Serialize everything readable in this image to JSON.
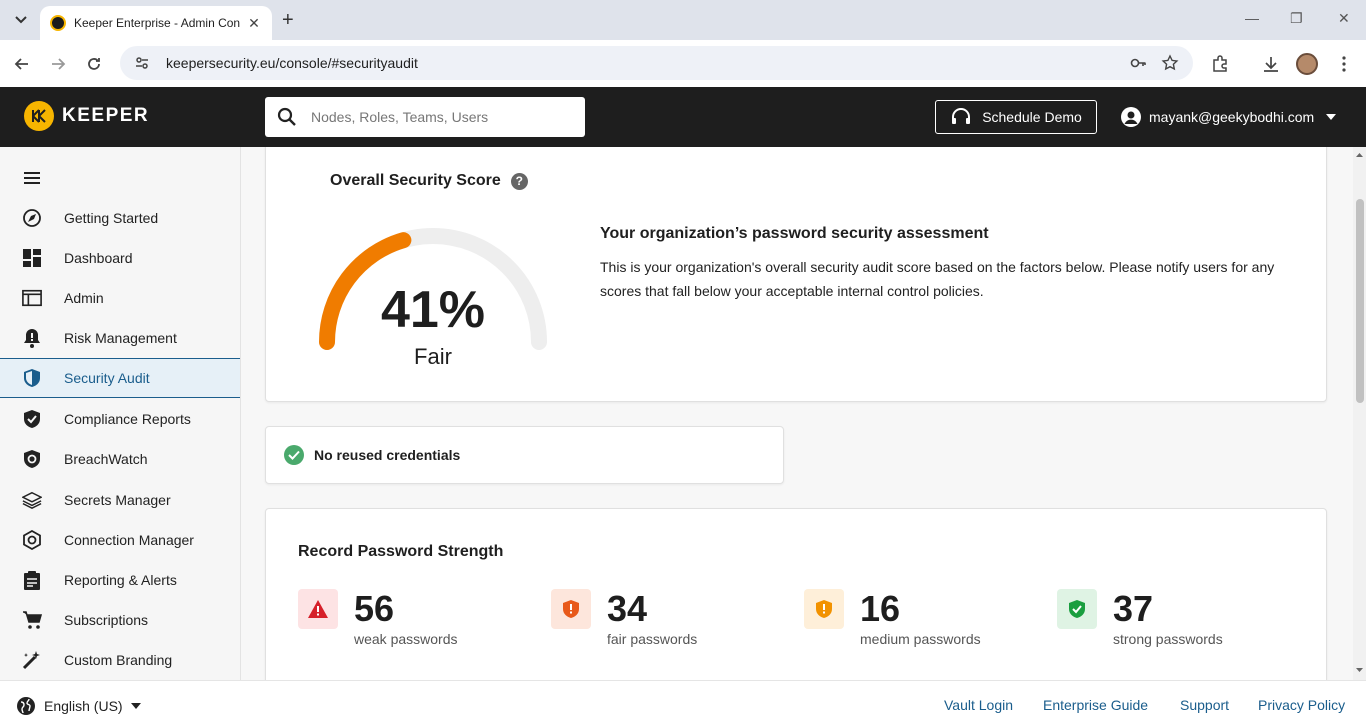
{
  "browser": {
    "tab_title": "Keeper Enterprise - Admin Con",
    "url": "keepersecurity.eu/console/#securityaudit"
  },
  "header": {
    "logo_text": "KEEPER",
    "search_placeholder": "Nodes, Roles, Teams, Users",
    "schedule_demo": "Schedule Demo",
    "user_email": "mayank@geekybodhi.com"
  },
  "sidebar": {
    "items": [
      {
        "label": "Getting Started",
        "icon": "rocket-icon"
      },
      {
        "label": "Dashboard",
        "icon": "dashboard-icon"
      },
      {
        "label": "Admin",
        "icon": "admin-icon"
      },
      {
        "label": "Risk Management",
        "icon": "bell-icon"
      },
      {
        "label": "Security Audit",
        "icon": "shield-icon",
        "active": true
      },
      {
        "label": "Compliance Reports",
        "icon": "compliance-icon"
      },
      {
        "label": "BreachWatch",
        "icon": "breachwatch-icon"
      },
      {
        "label": "Secrets Manager",
        "icon": "layers-icon"
      },
      {
        "label": "Connection Manager",
        "icon": "connection-icon"
      },
      {
        "label": "Reporting & Alerts",
        "icon": "clipboard-icon"
      },
      {
        "label": "Subscriptions",
        "icon": "cart-icon"
      },
      {
        "label": "Custom Branding",
        "icon": "branding-icon"
      }
    ]
  },
  "score": {
    "title": "Overall Security Score",
    "percent_value": 41,
    "percent_text": "41%",
    "grade": "Fair",
    "gauge_color": "#f07c00",
    "assessment_title": "Your organization’s password security assessment",
    "assessment_text": "This is your organization's overall security audit score based on the factors below. Please notify users for any scores that fall below your acceptable internal control policies."
  },
  "reuse": {
    "label": "No reused credentials"
  },
  "strength": {
    "title": "Record Password Strength",
    "stats": [
      {
        "value": "56",
        "label": "weak passwords",
        "color": "#d6202a"
      },
      {
        "value": "34",
        "label": "fair passwords",
        "color": "#e8591a"
      },
      {
        "value": "16",
        "label": "medium passwords",
        "color": "#f29200"
      },
      {
        "value": "37",
        "label": "strong passwords",
        "color": "#1a9e3f"
      }
    ]
  },
  "footer": {
    "language": "English (US)",
    "links": [
      "Vault Login",
      "Enterprise Guide",
      "Support",
      "Privacy Policy"
    ]
  }
}
